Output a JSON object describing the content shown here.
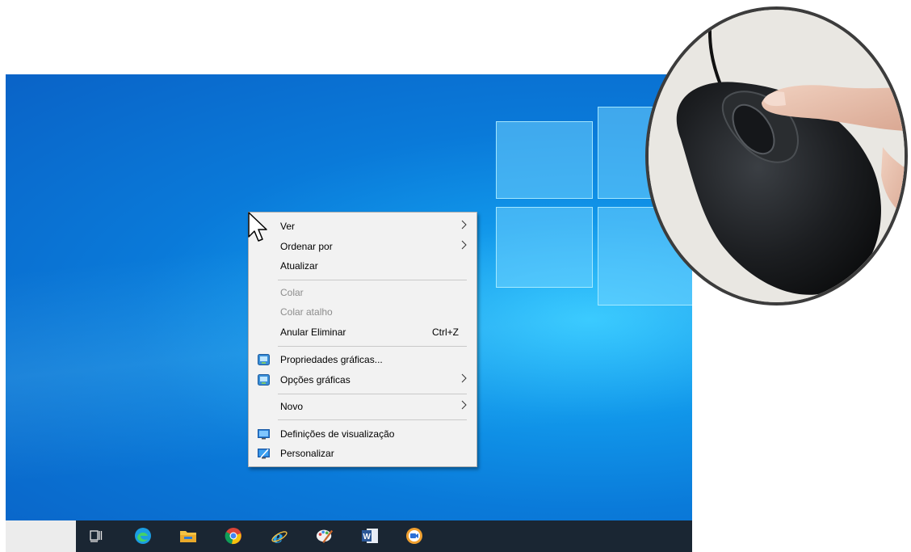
{
  "menu": {
    "items": [
      {
        "label": "Ver",
        "submenu": true,
        "icon": ""
      },
      {
        "label": "Ordenar por",
        "submenu": true,
        "icon": ""
      },
      {
        "label": "Atualizar",
        "submenu": false,
        "icon": ""
      },
      {
        "label": "Colar",
        "submenu": false,
        "disabled": true,
        "icon": ""
      },
      {
        "label": "Colar atalho",
        "submenu": false,
        "disabled": true,
        "icon": ""
      },
      {
        "label": "Anular Eliminar",
        "shortcut": "Ctrl+Z",
        "submenu": false,
        "icon": ""
      },
      {
        "label": "Propriedades gráficas...",
        "submenu": false,
        "icon": "intel-graphics-icon"
      },
      {
        "label": "Opções gráficas",
        "submenu": true,
        "icon": "intel-graphics-icon"
      },
      {
        "label": "Novo",
        "submenu": true,
        "icon": ""
      },
      {
        "label": "Definições de visualização",
        "submenu": false,
        "icon": "display-settings-icon"
      },
      {
        "label": "Personalizar",
        "submenu": false,
        "icon": "personalize-icon"
      }
    ]
  },
  "taskbar": {
    "icons": [
      "task-view-icon",
      "edge-icon",
      "file-explorer-icon",
      "chrome-icon",
      "internet-explorer-icon",
      "paint-icon",
      "word-icon",
      "camera-icon"
    ]
  },
  "colors": {
    "desktop": "#0a7ad9",
    "taskbar": "#1a2633",
    "menu_bg": "#f2f2f2",
    "disabled_text": "#8d8d8d"
  }
}
